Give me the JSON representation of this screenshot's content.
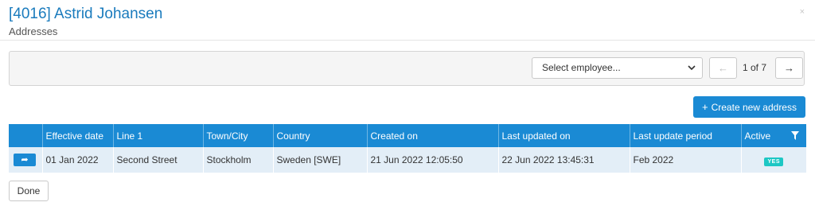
{
  "header": {
    "title": "[4016] Astrid Johansen",
    "subtitle": "Addresses",
    "close_label": "×"
  },
  "toolbar": {
    "employee_select": {
      "selected": "Select employee...",
      "chevron": "⌄"
    },
    "pager": {
      "prev": "←",
      "next": "→",
      "count": "1 of 7"
    }
  },
  "actions": {
    "create_icon": "+",
    "create_label": "Create new address",
    "done_label": "Done"
  },
  "table": {
    "columns": [
      "",
      "Effective date",
      "Line 1",
      "Town/City",
      "Country",
      "Created on",
      "Last updated on",
      "Last update period",
      "Active"
    ],
    "rows": [
      {
        "action_icon": "share-arrow-icon",
        "action_glyph": "➦",
        "effective_date": "01 Jan 2022",
        "line1": "Second Street",
        "town": "Stockholm",
        "country": "Sweden [SWE]",
        "created_on": "21 Jun 2022 12:05:50",
        "last_updated_on": "22 Jun 2022 13:45:31",
        "last_update_period": "Feb 2022",
        "active": "YES"
      }
    ]
  },
  "colors": {
    "accent": "#1a8ad4",
    "title": "#1a7bbd",
    "row_bg": "#e3eef7",
    "active_badge": "#1dc7c4"
  }
}
